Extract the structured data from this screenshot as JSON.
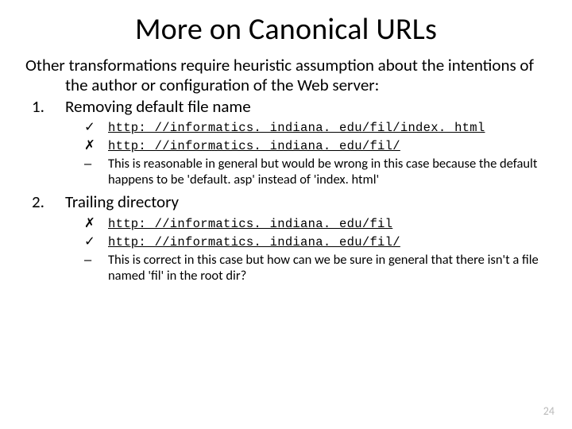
{
  "title": "More on Canonical URLs",
  "intro": "Other transformations require heuristic assumption about the intentions of the author or configuration of the Web server:",
  "items": [
    {
      "head": "Removing default file name",
      "subs": [
        {
          "bullet": "✓",
          "url": "http: //informatics. indiana. edu/fil/index. html"
        },
        {
          "bullet": "✗",
          "url": "http: //informatics. indiana. edu/fil/"
        },
        {
          "bullet": "–",
          "text": "This is reasonable in general but would be wrong in this case because the default happens to be 'default. asp' instead of 'index. html'"
        }
      ]
    },
    {
      "head": "Trailing directory",
      "subs": [
        {
          "bullet": "✗",
          "url": "http: //informatics. indiana. edu/fil"
        },
        {
          "bullet": "✓",
          "url": "http: //informatics. indiana. edu/fil/"
        },
        {
          "bullet": "–",
          "text": "This is correct in this case but how can we be sure in general that there isn't a file named 'fil' in the root dir?"
        }
      ]
    }
  ],
  "page_number": "24"
}
